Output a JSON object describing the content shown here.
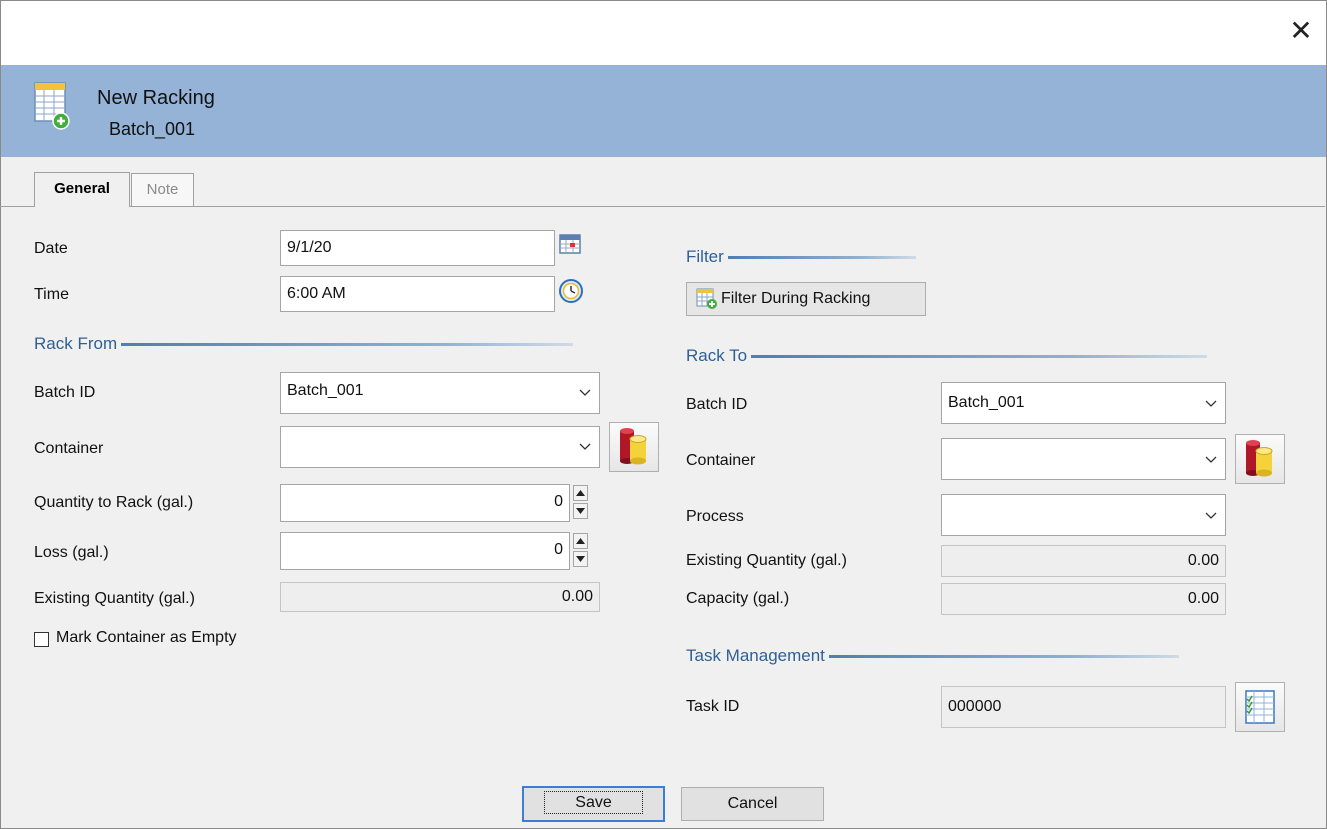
{
  "window": {
    "close_glyph": "✕"
  },
  "header": {
    "title": "New Racking",
    "subtitle": "Batch_001",
    "icon": "table-add-icon"
  },
  "tabs": [
    {
      "label": "General",
      "active": true
    },
    {
      "label": "Note",
      "active": false
    }
  ],
  "left": {
    "date_label": "Date",
    "date_value": "9/1/20",
    "time_label": "Time",
    "time_value": "6:00 AM",
    "rack_from_title": "Rack From",
    "batch_label": "Batch ID",
    "batch_value": "Batch_001",
    "container_label": "Container",
    "container_value": "",
    "qty_label": "Quantity to Rack (gal.)",
    "qty_value": "0",
    "loss_label": "Loss (gal.)",
    "loss_value": "0",
    "existing_label": "Existing Quantity (gal.)",
    "existing_value": "0.00",
    "empty_label": "Mark Container as Empty"
  },
  "right": {
    "filter_title": "Filter",
    "filter_button": "Filter During Racking",
    "rack_to_title": "Rack To",
    "batch_label": "Batch ID",
    "batch_value": "Batch_001",
    "container_label": "Container",
    "container_value": "",
    "process_label": "Process",
    "process_value": "",
    "existing_label": "Existing Quantity (gal.)",
    "existing_value": "0.00",
    "capacity_label": "Capacity (gal.)",
    "capacity_value": "0.00",
    "task_title": "Task Management",
    "task_label": "Task ID",
    "task_value": "000000"
  },
  "footer": {
    "save_label": "Save",
    "cancel_label": "Cancel"
  }
}
